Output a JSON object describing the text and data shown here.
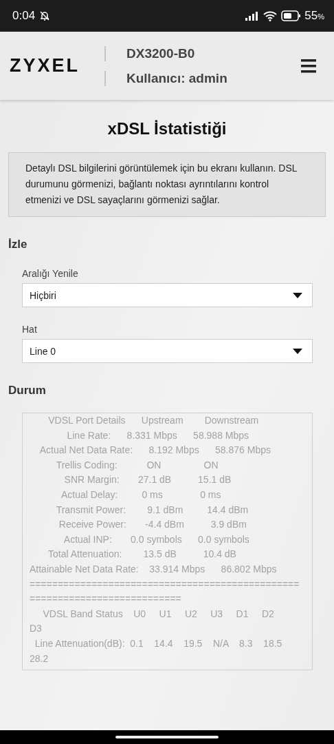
{
  "status_bar": {
    "time": "0:04",
    "battery": "55",
    "battery_unit": "%"
  },
  "header": {
    "logo": "ZYXEL",
    "model": "DX3200-B0",
    "user": "Kullanıcı: admin"
  },
  "title": "xDSL İstatistiği",
  "description": "Detaylı DSL bilgilerini görüntülemek için bu ekranı kullanın. DSL durumunu görmenizi, bağlantı noktası ayrıntılarını kontrol etmenizi ve DSL sayaçlarını görmenizi sağlar.",
  "monitor": {
    "heading": "İzle",
    "fields": [
      {
        "label": "Aralığı Yenile",
        "value": "Hiçbiri"
      },
      {
        "label": "Hat",
        "value": "Line 0"
      }
    ]
  },
  "status": {
    "heading": "Durum",
    "lines": [
      "       VDSL Port Details      Upstream        Downstream",
      "              Line Rate:      8.331 Mbps      58.988 Mbps",
      "    Actual Net Data Rate:      8.192 Mbps      58.876 Mbps",
      "          Trellis Coding:           ON                ON",
      "             SNR Margin:       27.1 dB          15.1 dB",
      "            Actual Delay:         0 ms              0 ms",
      "          Transmit Power:        9.1 dBm         14.4 dBm",
      "           Receive Power:       -4.4 dBm          3.9 dBm",
      "             Actual INP:       0.0 symbols      0.0 symbols",
      "       Total Attenuation:        13.5 dB          10.4 dB",
      "Attainable Net Data Rate:    33.914 Mbps      86.802 Mbps",
      "================================================",
      "===========================",
      "     VDSL Band Status    U0     U1     U2     U3     D1     D2",
      "D3",
      "  Line Attenuation(dB):  0.1    14.4    19.5    N/A    8.3    18.5",
      "28.2"
    ]
  }
}
